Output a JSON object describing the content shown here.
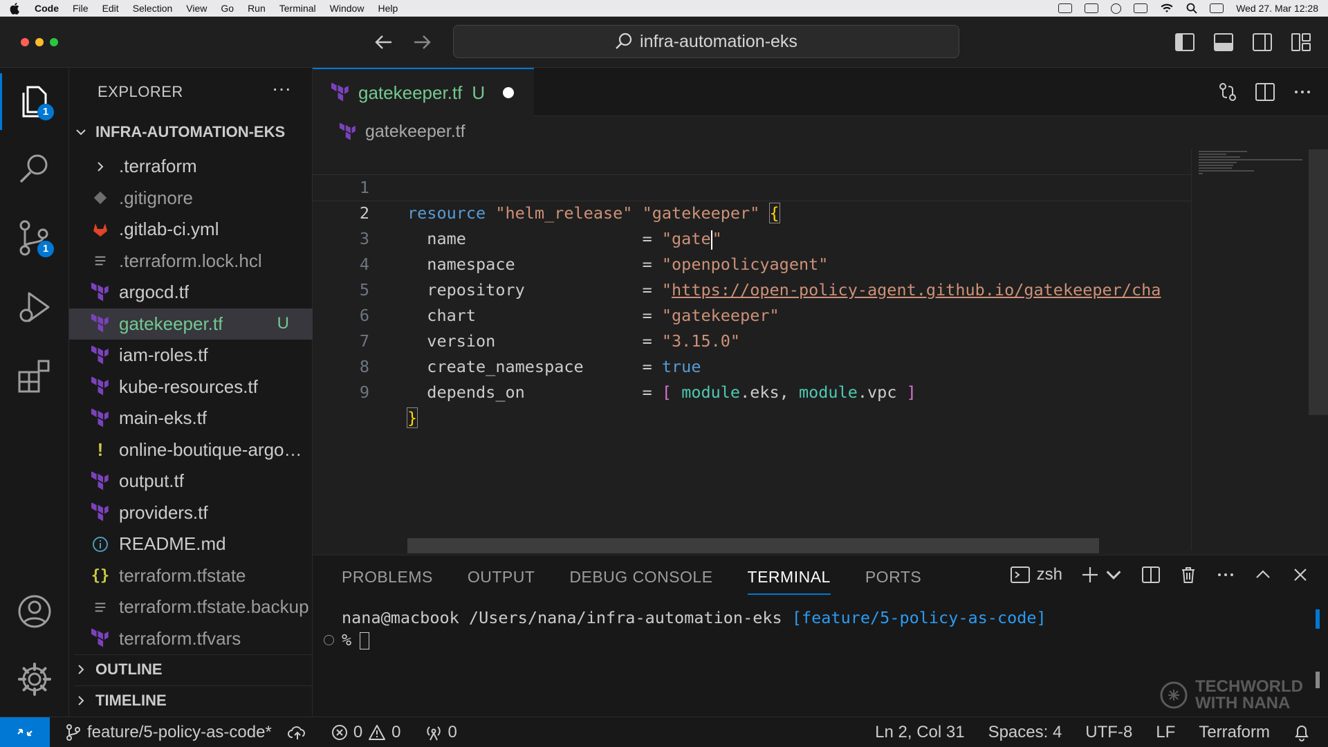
{
  "menubar": {
    "app": "Code",
    "items": [
      "File",
      "Edit",
      "Selection",
      "View",
      "Go",
      "Run",
      "Terminal",
      "Window",
      "Help"
    ],
    "clock": "Wed 27. Mar  12:28"
  },
  "titlebar": {
    "search_text": "infra-automation-eks"
  },
  "activity": {
    "explorer_badge": "1",
    "scm_badge": "1"
  },
  "sidebar": {
    "title": "EXPLORER",
    "root": "INFRA-AUTOMATION-EKS",
    "files": [
      {
        "name": ".terraform",
        "icon": "chevron-right-icon",
        "kind": "folder"
      },
      {
        "name": ".gitignore",
        "icon": "git-icon",
        "kind": "dim"
      },
      {
        "name": ".gitlab-ci.yml",
        "icon": "gitlab-icon",
        "kind": "normal"
      },
      {
        "name": ".terraform.lock.hcl",
        "icon": "lines-icon",
        "kind": "dim"
      },
      {
        "name": "argocd.tf",
        "icon": "terraform-icon",
        "kind": "normal"
      },
      {
        "name": "gatekeeper.tf",
        "icon": "terraform-icon",
        "kind": "untracked",
        "status": "U"
      },
      {
        "name": "iam-roles.tf",
        "icon": "terraform-icon",
        "kind": "normal"
      },
      {
        "name": "kube-resources.tf",
        "icon": "terraform-icon",
        "kind": "normal"
      },
      {
        "name": "main-eks.tf",
        "icon": "terraform-icon",
        "kind": "normal"
      },
      {
        "name": "online-boutique-argocd-application.yaml",
        "icon": "exclamation-icon",
        "kind": "normal"
      },
      {
        "name": "output.tf",
        "icon": "terraform-icon",
        "kind": "normal"
      },
      {
        "name": "providers.tf",
        "icon": "terraform-icon",
        "kind": "normal"
      },
      {
        "name": "README.md",
        "icon": "info-icon",
        "kind": "normal"
      },
      {
        "name": "terraform.tfstate",
        "icon": "braces-icon",
        "kind": "dim"
      },
      {
        "name": "terraform.tfstate.backup",
        "icon": "lines-icon",
        "kind": "dim"
      },
      {
        "name": "terraform.tfvars",
        "icon": "terraform-icon",
        "kind": "dim"
      }
    ],
    "outline": "OUTLINE",
    "timeline": "TIMELINE"
  },
  "editor": {
    "tab": {
      "name": "gatekeeper.tf",
      "status": "U"
    },
    "breadcrumb": "gatekeeper.tf",
    "lines": [
      "1",
      "2",
      "3",
      "4",
      "5",
      "6",
      "7",
      "8",
      "9"
    ],
    "code": {
      "l1_kw": "resource",
      "l1_type": "\"helm_release\"",
      "l1_name": "\"gatekeeper\"",
      "l1_brace": "{",
      "name_key": "name",
      "name_val": "\"gate",
      "name_val_end": "\"",
      "namespace_key": "namespace",
      "namespace_val": "\"openpolicyagent\"",
      "repository_key": "repository",
      "repository_q": "\"",
      "repository_val": "https://open-policy-agent.github.io/gatekeeper/cha",
      "chart_key": "chart",
      "chart_val": "\"gatekeeper\"",
      "version_key": "version",
      "version_val": "\"3.15.0\"",
      "create_ns_key": "create_namespace",
      "create_ns_val": "true",
      "depends_key": "depends_on",
      "depends_open": "[",
      "module1": "module",
      "eks": ".eks,",
      "module2": "module",
      "vpc": ".vpc",
      "depends_close": "]",
      "eq": "=",
      "l9_brace": "}"
    }
  },
  "panel": {
    "tabs": [
      "PROBLEMS",
      "OUTPUT",
      "DEBUG CONSOLE",
      "TERMINAL",
      "PORTS"
    ],
    "active_tab": "TERMINAL",
    "shell": "zsh",
    "prompt_path": "nana@macbook /Users/nana/infra-automation-eks",
    "prompt_branch": "[feature/5-policy-as-code]",
    "prompt_symbol": "%",
    "watermark_line1": "TECHWORLD",
    "watermark_line2": "WITH NANA"
  },
  "statusbar": {
    "branch": "feature/5-policy-as-code*",
    "errors": "0",
    "warnings": "0",
    "ports": "0",
    "position": "Ln 2, Col 31",
    "spaces": "Spaces: 4",
    "encoding": "UTF-8",
    "eol": "LF",
    "language": "Terraform"
  },
  "colors": {
    "accent": "#0078d4",
    "untracked": "#73c991",
    "keyword": "#569cd6",
    "string": "#ce9178",
    "module": "#4ec9b0",
    "terraform": "#7b42bc"
  }
}
